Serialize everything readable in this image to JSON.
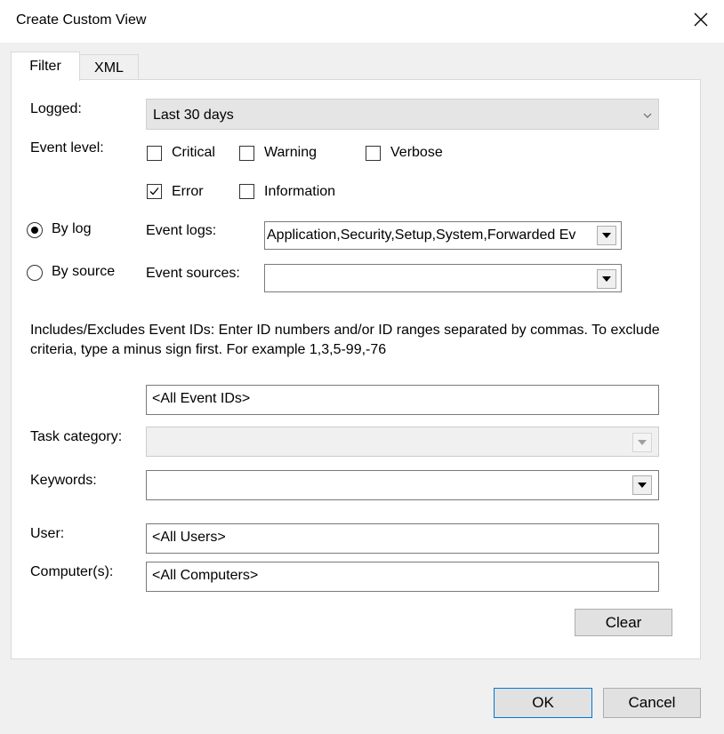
{
  "window": {
    "title": "Create Custom View"
  },
  "tabs": [
    {
      "label": "Filter"
    },
    {
      "label": "XML"
    }
  ],
  "filter": {
    "logged_label": "Logged:",
    "logged_value": "Last 30 days",
    "event_level_label": "Event level:",
    "levels": {
      "critical": "Critical",
      "warning": "Warning",
      "verbose": "Verbose",
      "error": "Error",
      "information": "Information"
    },
    "by_log_label": "By log",
    "by_source_label": "By source",
    "event_logs_label": "Event logs:",
    "event_logs_value": "Application,Security,Setup,System,Forwarded Ev",
    "event_sources_label": "Event sources:",
    "event_sources_value": "",
    "ids_help": "Includes/Excludes Event IDs: Enter ID numbers and/or ID ranges separated by commas. To exclude criteria, type a minus sign first. For example 1,3,5-99,-76",
    "event_ids_value": "<All Event IDs>",
    "task_category_label": "Task category:",
    "task_category_value": "",
    "keywords_label": "Keywords:",
    "keywords_value": "",
    "user_label": "User:",
    "user_value": "<All Users>",
    "computers_label": "Computer(s):",
    "computers_value": "<All Computers>",
    "clear_label": "Clear"
  },
  "footer": {
    "ok_label": "OK",
    "cancel_label": "Cancel"
  },
  "icons": {
    "close": "close-icon",
    "chevron": "chevron-down-icon",
    "checkmark": "checkmark-icon"
  }
}
